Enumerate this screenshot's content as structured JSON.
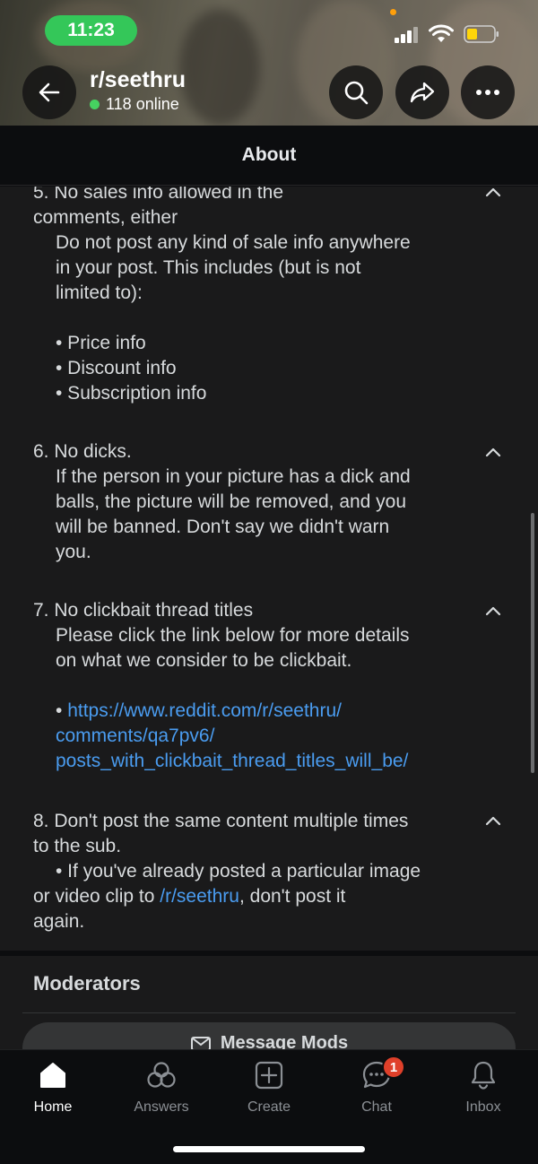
{
  "status_bar": {
    "time": "11:23"
  },
  "header": {
    "subreddit": "r/seethru",
    "online": "118 online",
    "back_icon": "arrow-left-icon",
    "search_icon": "search-icon",
    "share_icon": "share-icon",
    "more_icon": "more-dots-icon"
  },
  "about_bar": {
    "title": "About"
  },
  "rules": [
    {
      "title_lines": [
        "5. No sales info allowed in the",
        "comments, either"
      ],
      "body_lines": [
        "Do not post any kind of sale info anywhere",
        "in your post.  This includes (but is not",
        "limited to):",
        "",
        "• Price info",
        "• Discount info",
        "• Subscription info"
      ]
    },
    {
      "title_lines": [
        "6. No dicks."
      ],
      "body_lines": [
        "If the person in your picture has a dick and",
        "balls, the picture will be removed, and you",
        "will be banned. Don't say we didn't warn",
        "you."
      ]
    },
    {
      "title_lines": [
        "7. No clickbait thread titles"
      ],
      "body_lines": [
        "Please click the link below for more details",
        "on what we consider to be clickbait.",
        ""
      ],
      "link_bullet": "• ",
      "link_lines": [
        "https://www.reddit.com/r/seethru/",
        "comments/qa7pv6/",
        "posts_with_clickbait_thread_titles_will_be/"
      ]
    },
    {
      "title_lines": [
        "8. Don't post the same content multiple times",
        "to the sub."
      ],
      "body_lines": [
        "• If you've already posted a particular image"
      ],
      "mixed_line": {
        "before": "or video clip to ",
        "link": "/r/seethru",
        "after": ", don't post it"
      },
      "last_line": "again."
    }
  ],
  "moderators": {
    "title": "Moderators",
    "message_button": "Message Mods"
  },
  "tabs": [
    {
      "label": "Home",
      "icon": "home-icon",
      "active": true
    },
    {
      "label": "Answers",
      "icon": "answers-icon",
      "active": false
    },
    {
      "label": "Create",
      "icon": "create-plus-icon",
      "active": false
    },
    {
      "label": "Chat",
      "icon": "chat-icon",
      "active": false,
      "badge": "1"
    },
    {
      "label": "Inbox",
      "icon": "bell-icon",
      "active": false
    }
  ],
  "colors": {
    "link": "#4a9cf0",
    "online_dot": "#46d160",
    "time_pill": "#34c759",
    "badge": "#e0402a"
  }
}
